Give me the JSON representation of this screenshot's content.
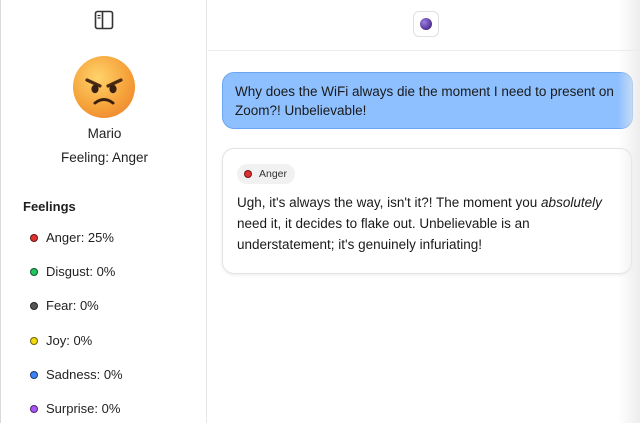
{
  "sidebar": {
    "toggle_icon": "sidebar-toggle-icon",
    "avatar_icon": "angry-face-emoji",
    "user_name": "Mario",
    "feeling_label": "Feeling: Anger",
    "feelings_heading": "Feelings",
    "feelings": [
      {
        "label": "Anger: 25%",
        "color": "#e0302f"
      },
      {
        "label": "Disgust: 0%",
        "color": "#22c55e"
      },
      {
        "label": "Fear: 0%",
        "color": "#555555"
      },
      {
        "label": "Joy: 0%",
        "color": "#f5d90a"
      },
      {
        "label": "Sadness: 0%",
        "color": "#3b82f6"
      },
      {
        "label": "Surprise: 0%",
        "color": "#a855f7"
      }
    ]
  },
  "header": {
    "orb_icon": "purple-orb-icon"
  },
  "messages": {
    "user": "Why does the WiFi always die the moment I need to present on Zoom?! Unbelievable!",
    "assistant": {
      "emotion_tag": "Anger",
      "emotion_color": "#e0302f",
      "text_before": "Ugh, it's always the way, isn't it?! The moment you ",
      "text_emphasis": "absolutely",
      "text_after": " need it, it decides to flake out. Unbelievable is an understatement; it's genuinely infuriating!"
    }
  }
}
